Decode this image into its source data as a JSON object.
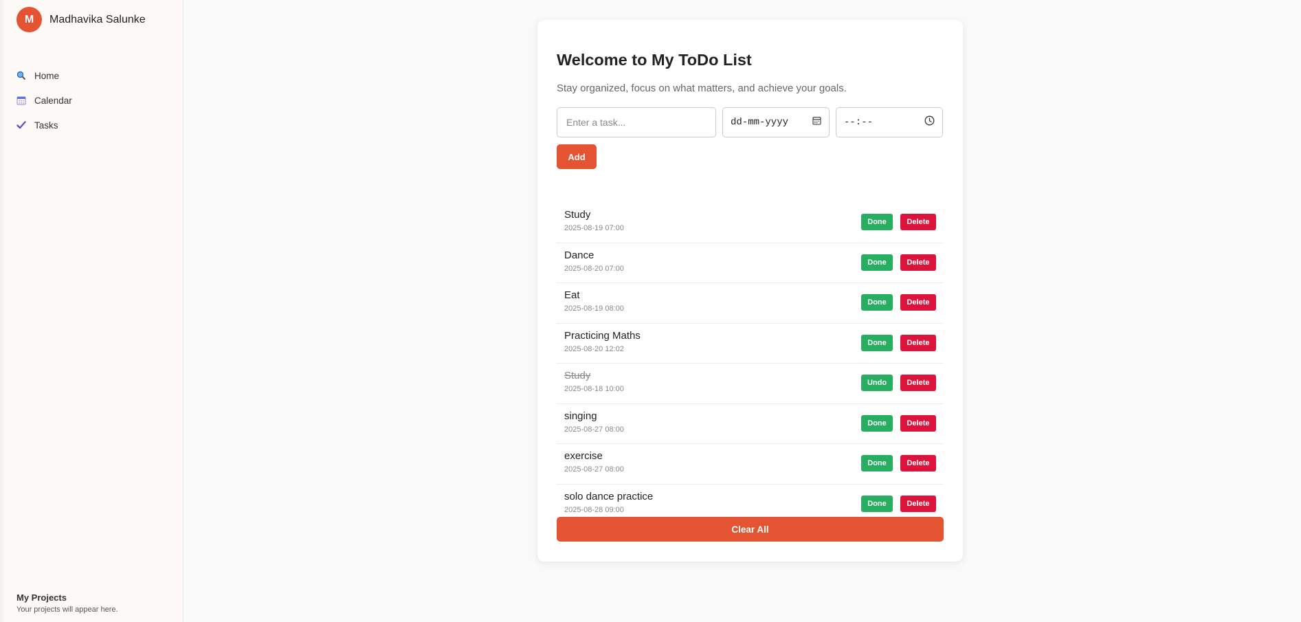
{
  "sidebar": {
    "avatar_initial": "M",
    "user_name": "Madhavika Salunke",
    "nav": [
      {
        "label": "Home",
        "icon": "magnifier-icon"
      },
      {
        "label": "Calendar",
        "icon": "calendar-icon"
      },
      {
        "label": "Tasks",
        "icon": "check-icon"
      }
    ],
    "projects_title": "My Projects",
    "projects_subtitle": "Your projects will appear here."
  },
  "main": {
    "title": "Welcome to My ToDo List",
    "subtitle": "Stay organized, focus on what matters, and achieve your goals.",
    "task_input": {
      "placeholder": "Enter a task...",
      "value": ""
    },
    "date_input": {
      "placeholder": "dd-mm-yyyy"
    },
    "time_input": {
      "placeholder": "--:--"
    },
    "add_label": "Add",
    "clear_label": "Clear All"
  },
  "tasks": [
    {
      "name": "Study",
      "datetime": "2025-08-19 07:00",
      "done": false,
      "action_label": "Done",
      "delete_label": "Delete"
    },
    {
      "name": "Dance",
      "datetime": "2025-08-20 07:00",
      "done": false,
      "action_label": "Done",
      "delete_label": "Delete"
    },
    {
      "name": "Eat",
      "datetime": "2025-08-19 08:00",
      "done": false,
      "action_label": "Done",
      "delete_label": "Delete"
    },
    {
      "name": "Practicing Maths",
      "datetime": "2025-08-20 12:02",
      "done": false,
      "action_label": "Done",
      "delete_label": "Delete"
    },
    {
      "name": "Study",
      "datetime": "2025-08-18 10:00",
      "done": true,
      "action_label": "Undo",
      "delete_label": "Delete"
    },
    {
      "name": "singing",
      "datetime": "2025-08-27 08:00",
      "done": false,
      "action_label": "Done",
      "delete_label": "Delete"
    },
    {
      "name": "exercise",
      "datetime": "2025-08-27 08:00",
      "done": false,
      "action_label": "Done",
      "delete_label": "Delete"
    },
    {
      "name": "solo dance practice",
      "datetime": "2025-08-28 09:00",
      "done": false,
      "action_label": "Done",
      "delete_label": "Delete"
    }
  ],
  "colors": {
    "accent": "#e45433",
    "done_green": "#27ae60",
    "delete_red": "#dc143c"
  }
}
